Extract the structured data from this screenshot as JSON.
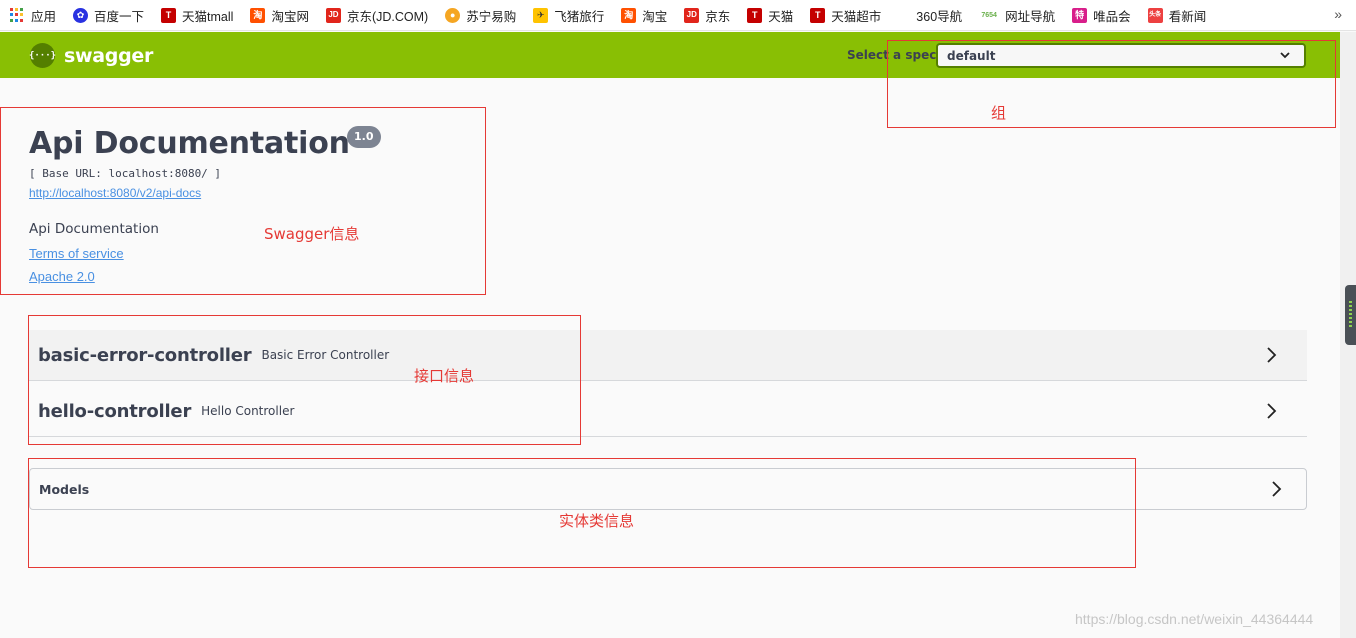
{
  "bookmarks": {
    "items": [
      {
        "label": "应用",
        "icon": "apps-grid-icon",
        "color": "#e53935"
      },
      {
        "label": "百度一下",
        "icon": "baidu-paw-icon",
        "color": "#2932e1"
      },
      {
        "label": "天猫tmall",
        "icon": "tmall-icon",
        "color": "#c40000"
      },
      {
        "label": "淘宝网",
        "icon": "taobao-icon",
        "color": "#ff5000"
      },
      {
        "label": "京东(JD.COM)",
        "icon": "jd-icon",
        "color": "#e1251b"
      },
      {
        "label": "苏宁易购",
        "icon": "suning-lion-icon",
        "color": "#f5a623"
      },
      {
        "label": "飞猪旅行",
        "icon": "fliggy-icon",
        "color": "#ffc300"
      },
      {
        "label": "淘宝",
        "icon": "taobao-icon",
        "color": "#ff5000"
      },
      {
        "label": "京东",
        "icon": "jd-icon",
        "color": "#e1251b"
      },
      {
        "label": "天猫",
        "icon": "tmall-icon",
        "color": "#c40000"
      },
      {
        "label": "天猫超市",
        "icon": "tmall-icon",
        "color": "#c40000"
      },
      {
        "label": "360导航",
        "icon": "blank-icon",
        "color": "#ffffff"
      },
      {
        "label": "网址导航",
        "icon": "7654-icon",
        "color": "#6ab04c"
      },
      {
        "label": "唯品会",
        "icon": "vip-icon",
        "color": "#d81e8a"
      },
      {
        "label": "看新闻",
        "icon": "toutiao-icon",
        "color": "#ed4040"
      }
    ],
    "more": "»"
  },
  "header": {
    "brand": "swagger",
    "logo_glyph": "{···}",
    "spec_label": "Select a spec",
    "spec_value": "default",
    "accent": "#89bf04"
  },
  "info": {
    "title": "Api Documentation",
    "version": "1.0",
    "base_url": "[ Base URL: localhost:8080/ ]",
    "api_docs_url": "http://localhost:8080/v2/api-docs",
    "description": "Api Documentation",
    "terms": "Terms of service",
    "license": "Apache 2.0"
  },
  "controllers": [
    {
      "name": "basic-error-controller",
      "description": "Basic Error Controller"
    },
    {
      "name": "hello-controller",
      "description": "Hello Controller"
    }
  ],
  "models": {
    "title": "Models"
  },
  "annotations": {
    "group": "组",
    "swagger_info": "Swagger信息",
    "api_info": "接口信息",
    "entity_info": "实体类信息",
    "color": "#e53935"
  },
  "watermark": "https://blog.csdn.net/weixin_44364444"
}
